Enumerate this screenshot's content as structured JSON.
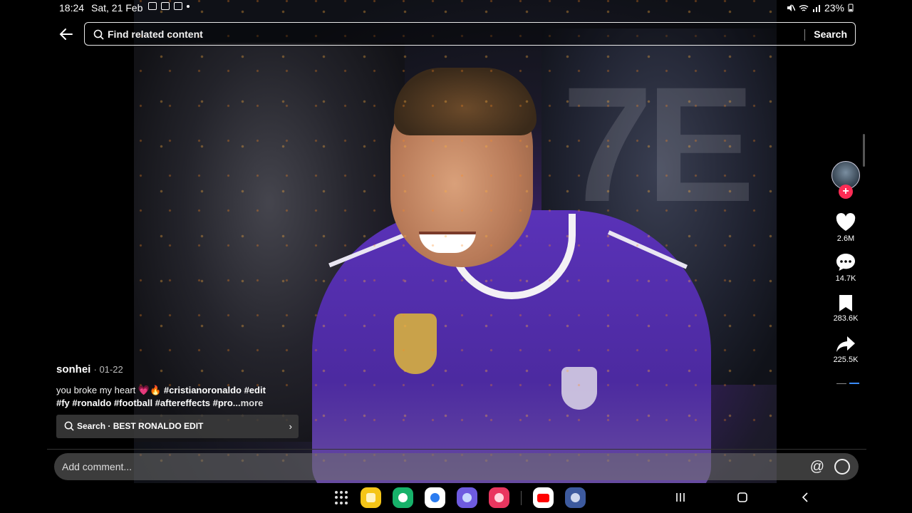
{
  "status_bar": {
    "time": "18:24",
    "date": "Sat, 21 Feb",
    "battery": "23%"
  },
  "search": {
    "placeholder": "Find related content",
    "button_label": "Search"
  },
  "video": {
    "background_text": "7E"
  },
  "rail": {
    "likes": "2.6M",
    "comments": "14.7K",
    "saves": "283.6K",
    "shares": "225.5K"
  },
  "caption": {
    "author": "sonhei",
    "date": "· 01-22",
    "text_prefix": "you broke my heart ",
    "emojis": "💗🔥",
    "hashtags_line1": "#cristianoronaldo #edit",
    "hashtags_line2": "#fy #ronaldo #football #aftereffects #pro",
    "more_label": "...more"
  },
  "search_chip": {
    "label": "Search · BEST RONALDO EDIT"
  },
  "comment_bar": {
    "placeholder": "Add comment...",
    "mention_icon": "@"
  },
  "colors": {
    "accent": "#fe2c55",
    "jersey": "#5a32b8"
  },
  "icons": [
    "back-arrow-icon",
    "search-icon",
    "heart-icon",
    "comment-icon",
    "bookmark-icon",
    "share-icon",
    "emoji-icon",
    "apps-grid-icon"
  ]
}
